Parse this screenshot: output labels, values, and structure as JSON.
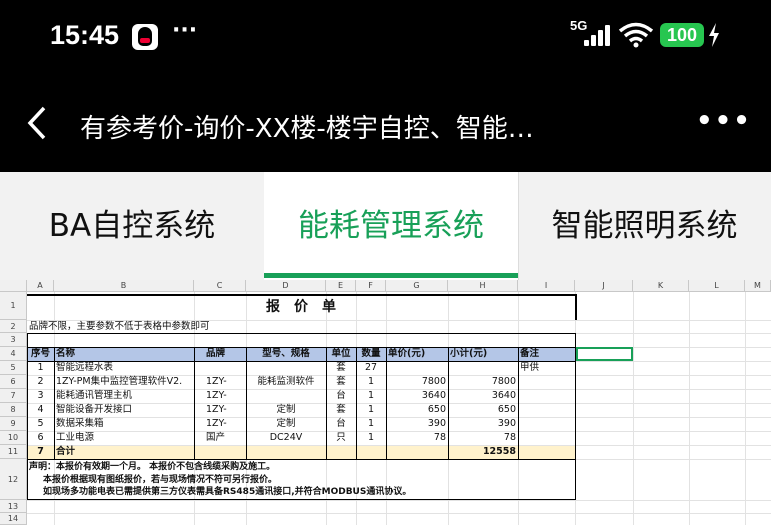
{
  "status": {
    "time": "15:45",
    "network": "5G",
    "battery": "100",
    "overflow": "···"
  },
  "app": {
    "title": "有参考价-询价-XX楼-楼宇自控、智能…",
    "more": "•••"
  },
  "tabs": [
    {
      "label": "BA自控系统"
    },
    {
      "label": "能耗管理系统"
    },
    {
      "label": "智能照明系统"
    }
  ],
  "active_tab": 1,
  "sheet": {
    "columns": [
      "A",
      "B",
      "C",
      "D",
      "E",
      "F",
      "G",
      "H",
      "I",
      "J",
      "K",
      "L",
      "M"
    ],
    "rows": [
      "1",
      "2",
      "3",
      "4",
      "5",
      "6",
      "7",
      "8",
      "9",
      "10",
      "11",
      "12",
      "13",
      "14"
    ],
    "title": "报　价　单",
    "note": "品牌不限，主要参数不低于表格中参数即可",
    "headers": {
      "no": "序号",
      "name": "名称",
      "brand": "品牌",
      "model": "型号、规格",
      "unit": "单位",
      "qty": "数量",
      "price": "单价(元)",
      "subtotal": "小计(元)",
      "remark": "备注"
    },
    "items": [
      {
        "no": "1",
        "name": "智能远程水表",
        "brand": "",
        "model": "",
        "unit": "套",
        "qty": "27",
        "price": "",
        "subtotal": "",
        "remark": "甲供"
      },
      {
        "no": "2",
        "name": "1ZY-PM集中监控管理软件V2.",
        "brand": "1ZY-",
        "model": "能耗监测软件",
        "unit": "套",
        "qty": "1",
        "price": "7800",
        "subtotal": "7800",
        "remark": ""
      },
      {
        "no": "3",
        "name": "能耗通讯管理主机",
        "brand": "1ZY-",
        "model": "",
        "unit": "台",
        "qty": "1",
        "price": "3640",
        "subtotal": "3640",
        "remark": ""
      },
      {
        "no": "4",
        "name": "智能设备开发接口",
        "brand": "1ZY-",
        "model": "定制",
        "unit": "套",
        "qty": "1",
        "price": "650",
        "subtotal": "650",
        "remark": ""
      },
      {
        "no": "5",
        "name": "数据采集箱",
        "brand": "1ZY-",
        "model": "定制",
        "unit": "台",
        "qty": "1",
        "price": "390",
        "subtotal": "390",
        "remark": ""
      },
      {
        "no": "6",
        "name": "工业电源",
        "brand": "国产",
        "model": "DC24V",
        "unit": "只",
        "qty": "1",
        "price": "78",
        "subtotal": "78",
        "remark": ""
      }
    ],
    "total": {
      "no": "7",
      "label": "合计",
      "value": "12558"
    },
    "declaration": [
      "声明：本报价有效期一个月。  本报价不包含线缆采购及施工。",
      "本报价根据现有图纸报价，若与现场情况不符可另行报价。",
      "如现场多功能电表已需提供第三方仪表需具备RS485通讯接口,并符合MODBUS通讯协议。"
    ]
  },
  "colors": {
    "accent": "#18a058",
    "header_fill": "#b4c6e7",
    "total_fill": "#fff2cc",
    "battery": "#27c650"
  }
}
